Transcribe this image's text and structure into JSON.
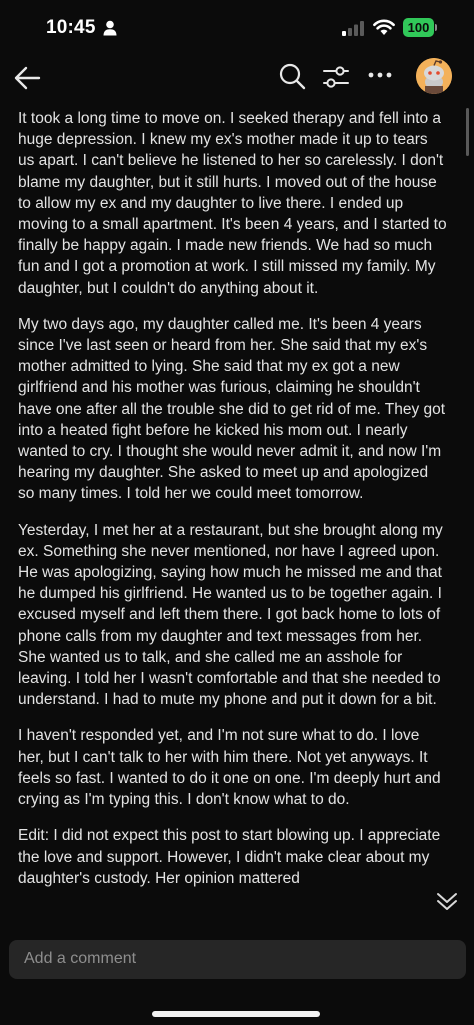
{
  "status_bar": {
    "time": "10:45",
    "battery": "100",
    "battery_color": "#31c859"
  },
  "nav": {
    "icons": [
      "arrow-left-icon",
      "search-icon",
      "sliders-icon",
      "more-horizontal-icon",
      "avatar"
    ]
  },
  "post": {
    "paragraphs": [
      "It took a long time to move on. I seeked therapy and fell into a huge depression. I knew my ex's mother made it up to tears us apart. I can't believe he listened to her so carelessly. I don't blame my daughter, but it still hurts. I moved out of the house to allow my ex and my daughter to live there. I ended up moving to a small apartment. It's been 4 years, and I started to finally be happy again. I made new friends. We had so much fun and I got a promotion at work. I still missed my family. My daughter, but I couldn't do anything about it.",
      "My two days ago, my daughter called me. It's been 4 years since I've last seen or heard from her. She said that my ex's mother admitted to lying. She said that my ex got a new girlfriend and his mother was furious, claiming he shouldn't have one after all the trouble she did to get rid of me. They got into a heated fight before he kicked his mom out. I nearly wanted to cry. I thought she would never admit it, and now I'm hearing my daughter. She asked to meet up and apologized so many times. I told her we could meet tomorrow.",
      "Yesterday, I met her at a restaurant, but she brought along my ex. Something she never mentioned, nor have I agreed upon. He was apologizing, saying how much he missed me and that he dumped his girlfriend. He wanted us to be together again. I excused myself and left them there. I got back home to lots of phone calls from my daughter and text messages from her. She wanted us to talk, and she called me an asshole for leaving. I told her I wasn't comfortable and that she needed to understand. I had to mute my phone and put it down for a bit.",
      "I haven't responded yet, and I'm not sure what to do. I love her, but I can't talk to her with him there. Not yet anyways. It feels so fast. I wanted to do it one on one. I'm deeply hurt and crying as I'm typing this. I don't know what to do.",
      "Edit: I did not expect this post to start blowing up. I appreciate the love and support. However, I didn't make clear about my daughter's custody. Her opinion mattered"
    ]
  },
  "comment_input": {
    "placeholder": "Add a comment"
  }
}
